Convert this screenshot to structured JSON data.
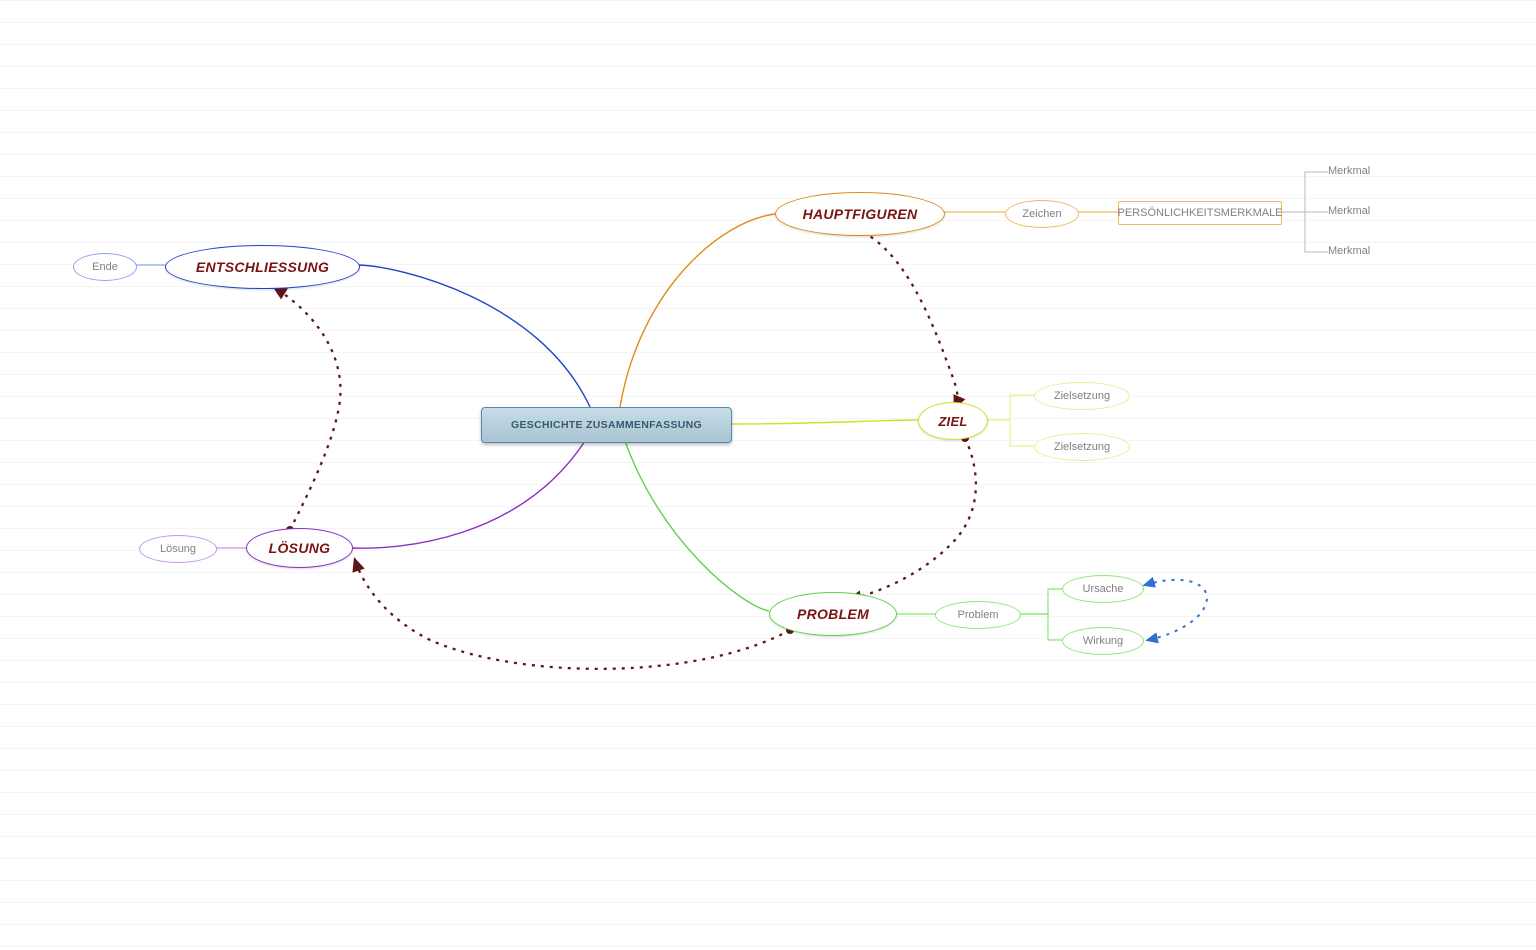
{
  "central": {
    "label": "GESCHICHTE ZUSAMMENFASSUNG"
  },
  "branches": {
    "hauptfiguren": {
      "label": "HAUPTFIGUREN",
      "zeichen": {
        "label": "Zeichen"
      },
      "merkmale": {
        "label": "PERSÖNLICHKEITSMERKMALE",
        "items": [
          "Merkmal",
          "Merkmal",
          "Merkmal"
        ]
      }
    },
    "ziel": {
      "label": "ZIEL",
      "items": [
        "Zielsetzung",
        "Zielsetzung"
      ]
    },
    "problem": {
      "label": "PROBLEM",
      "sub": {
        "label": "Problem",
        "ursache": "Ursache",
        "wirkung": "Wirkung"
      }
    },
    "loesung": {
      "label": "LÖSUNG",
      "sub": {
        "label": "Lösung"
      }
    },
    "entschliessung": {
      "label": "ENTSCHLIESSUNG",
      "sub": {
        "label": "Ende"
      }
    }
  },
  "colors": {
    "orange": "#e08b1d",
    "yellow": "#d6df2a",
    "green": "#5fd24a",
    "purple": "#8a2fc2",
    "blue": "#2142c8",
    "greensub": "#8ae872",
    "purplesub": "#c692ef",
    "bluesub": "#8fa4ef",
    "orangesub": "#f1b65f",
    "yellowsub": "#e9ef92",
    "arrowRed": "#5f1616",
    "arrowBlue": "#2f6fd3"
  }
}
